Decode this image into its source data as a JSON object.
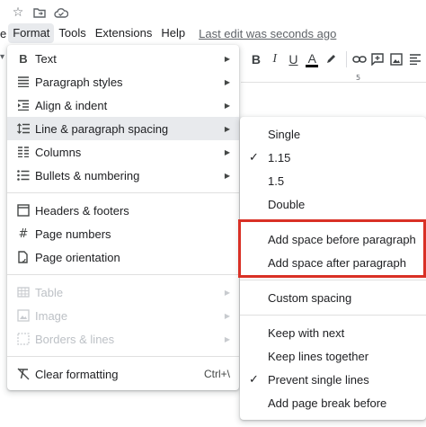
{
  "title_bar": {
    "icons": [
      "star-icon",
      "move-to-folder-icon",
      "cloud-saved-icon"
    ]
  },
  "menubar": {
    "lead": "e",
    "items": [
      "Format",
      "Tools",
      "Extensions",
      "Help"
    ],
    "active": "Format",
    "last_edit": "Last edit was seconds ago"
  },
  "toolbar": {
    "bold": "B",
    "italic": "I",
    "underline": "U",
    "text_color": "A"
  },
  "ruler": {
    "mark": "5"
  },
  "format_menu": {
    "items": [
      {
        "label": "Text",
        "icon": "bold-icon",
        "submenu": true
      },
      {
        "label": "Paragraph styles",
        "icon": "paragraph-styles-icon",
        "submenu": true
      },
      {
        "label": "Align & indent",
        "icon": "align-indent-icon",
        "submenu": true
      },
      {
        "label": "Line & paragraph spacing",
        "icon": "line-spacing-icon",
        "submenu": true,
        "highlighted": true
      },
      {
        "label": "Columns",
        "icon": "columns-icon",
        "submenu": true
      },
      {
        "label": "Bullets & numbering",
        "icon": "bullets-icon",
        "submenu": true
      },
      {
        "label": "Headers & footers",
        "icon": "headers-footers-icon",
        "submenu": false
      },
      {
        "label": "Page numbers",
        "icon": "hash-icon",
        "submenu": false
      },
      {
        "label": "Page orientation",
        "icon": "page-orientation-icon",
        "submenu": false
      },
      {
        "label": "Table",
        "icon": "table-icon",
        "submenu": true,
        "disabled": true
      },
      {
        "label": "Image",
        "icon": "image-icon",
        "submenu": true,
        "disabled": true
      },
      {
        "label": "Borders & lines",
        "icon": "borders-icon",
        "submenu": true,
        "disabled": true
      },
      {
        "label": "Clear formatting",
        "icon": "clear-formatting-icon",
        "shortcut": "Ctrl+\\"
      }
    ]
  },
  "spacing_submenu": {
    "items": [
      {
        "label": "Single",
        "checked": false
      },
      {
        "label": "1.15",
        "checked": true
      },
      {
        "label": "1.5",
        "checked": false
      },
      {
        "label": "Double",
        "checked": false
      },
      {
        "label": "Add space before paragraph",
        "checked": false
      },
      {
        "label": "Add space after paragraph",
        "checked": false
      },
      {
        "label": "Custom spacing",
        "checked": false
      },
      {
        "label": "Keep with next",
        "checked": false
      },
      {
        "label": "Keep lines together",
        "checked": false
      },
      {
        "label": "Prevent single lines",
        "checked": true
      },
      {
        "label": "Add page break before",
        "checked": false
      }
    ],
    "highlight_color": "#d93025"
  },
  "colors": {
    "hover_bg": "#e8eaed",
    "disabled_text": "#bdc1c6",
    "annotation_red": "#d93025"
  }
}
